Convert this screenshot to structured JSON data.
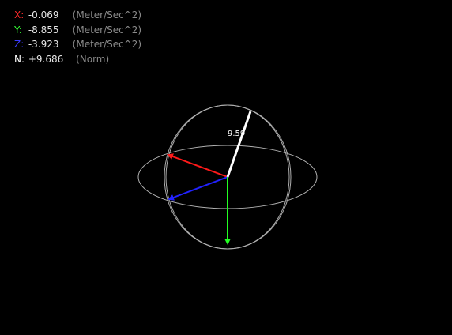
{
  "readout": {
    "x": {
      "label": "X:",
      "value": "-0.069",
      "unit": "(Meter/Sec^2)",
      "color": "#ff2a2a"
    },
    "y": {
      "label": "Y:",
      "value": "-8.855",
      "unit": "(Meter/Sec^2)",
      "color": "#33ff33"
    },
    "z": {
      "label": "Z:",
      "value": "-3.923",
      "unit": "(Meter/Sec^2)",
      "color": "#3a3aff"
    },
    "n": {
      "label": "N:",
      "value": "+9.686",
      "unit": "(Norm)",
      "color": "#ffffff"
    }
  },
  "visualization": {
    "norm_label": "9.59",
    "colors": {
      "x_vector": "#ff1a1a",
      "y_vector": "#22ff22",
      "z_vector": "#2222ff",
      "norm_vector": "#ffffff",
      "sphere_lines": "#b0b0b0"
    }
  }
}
